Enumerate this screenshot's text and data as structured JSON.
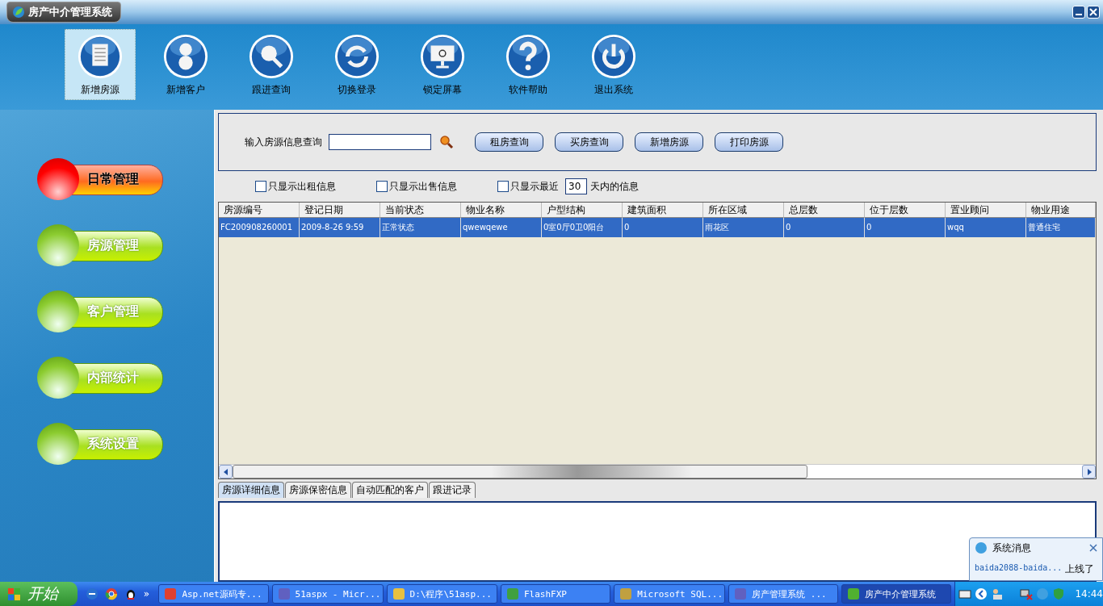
{
  "window": {
    "title": "房产中介管理系统"
  },
  "toolbar": [
    {
      "label": "新增房源",
      "selected": true
    },
    {
      "label": "新增客户",
      "selected": false
    },
    {
      "label": "跟进查询",
      "selected": false
    },
    {
      "label": "切换登录",
      "selected": false
    },
    {
      "label": "锁定屏幕",
      "selected": false
    },
    {
      "label": "软件帮助",
      "selected": false
    },
    {
      "label": "退出系统",
      "selected": false
    }
  ],
  "sidebar": {
    "items": [
      {
        "label": "日常管理",
        "selected": true
      },
      {
        "label": "房源管理",
        "selected": false
      },
      {
        "label": "客户管理",
        "selected": false
      },
      {
        "label": "内部统计",
        "selected": false
      },
      {
        "label": "系统设置",
        "selected": false
      }
    ]
  },
  "search": {
    "label": "输入房源信息查询",
    "buttons": [
      "租房查询",
      "买房查询",
      "新增房源",
      "打印房源"
    ]
  },
  "filters": [
    {
      "kind": "plain",
      "label": "只显示出租信息",
      "checked": false
    },
    {
      "kind": "plain",
      "label": "只显示出售信息",
      "checked": false
    },
    {
      "kind": "days",
      "label": "只显示最近",
      "checked": false,
      "days": "30",
      "suffix": "天内的信息"
    }
  ],
  "table": {
    "columns": [
      "房源编号",
      "登记日期",
      "当前状态",
      "物业名称",
      "户型结构",
      "建筑面积",
      "所在区域",
      "总层数",
      "位于层数",
      "置业顾问",
      "物业用途"
    ],
    "rows": [
      {
        "selected": true,
        "cells": [
          "FC200908260001",
          "2009-8-26 9:59",
          "正常状态",
          "qwewqewe",
          "0室0厅0卫0阳台",
          "0",
          "雨花区",
          "0",
          "0",
          "wqq",
          "普通住宅"
        ]
      }
    ]
  },
  "detail_tabs": [
    {
      "label": "房源详细信息",
      "selected": true
    },
    {
      "label": "房源保密信息",
      "selected": false
    },
    {
      "label": "自动匹配的客户",
      "selected": false
    },
    {
      "label": "跟进记录",
      "selected": false
    }
  ],
  "notification": {
    "title": "系统消息",
    "link": "baida2088-baida...",
    "message": "上线了"
  },
  "taskbar": {
    "start": "开始",
    "more": "»",
    "tasks": [
      {
        "label": "Asp.net源码专...",
        "selected": false
      },
      {
        "label": "51aspx - Micr...",
        "selected": false
      },
      {
        "label": "D:\\程序\\51asp...",
        "selected": false
      },
      {
        "label": "FlashFXP",
        "selected": false
      },
      {
        "label": "Microsoft SQL...",
        "selected": false
      },
      {
        "label": "房产管理系统 ...",
        "selected": false
      },
      {
        "label": "房产中介管理系统",
        "selected": true
      }
    ],
    "clock": "14:44"
  }
}
